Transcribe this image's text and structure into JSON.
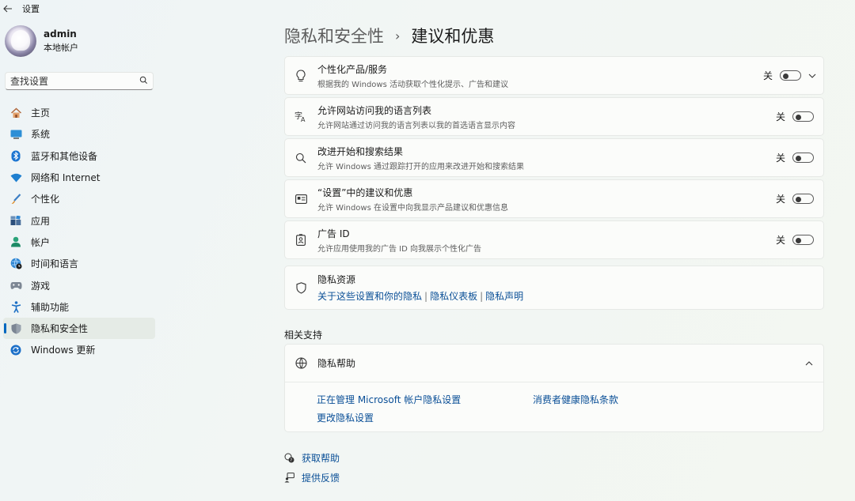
{
  "app": {
    "title": "设置"
  },
  "profile": {
    "name": "admin",
    "account_type": "本地帐户"
  },
  "search": {
    "placeholder": "查找设置"
  },
  "nav": [
    {
      "label": "主页",
      "icon": "home-icon"
    },
    {
      "label": "系统",
      "icon": "system-icon"
    },
    {
      "label": "蓝牙和其他设备",
      "icon": "bluetooth-icon"
    },
    {
      "label": "网络和 Internet",
      "icon": "wifi-icon"
    },
    {
      "label": "个性化",
      "icon": "brush-icon"
    },
    {
      "label": "应用",
      "icon": "apps-icon"
    },
    {
      "label": "帐户",
      "icon": "person-icon"
    },
    {
      "label": "时间和语言",
      "icon": "globe-clock-icon"
    },
    {
      "label": "游戏",
      "icon": "gamepad-icon"
    },
    {
      "label": "辅助功能",
      "icon": "accessibility-icon"
    },
    {
      "label": "隐私和安全性",
      "icon": "shield-icon",
      "active": true
    },
    {
      "label": "Windows 更新",
      "icon": "update-icon"
    }
  ],
  "breadcrumb": {
    "parent": "隐私和安全性",
    "separator": "›",
    "current": "建议和优惠"
  },
  "settings": [
    {
      "title": "个性化产品/服务",
      "desc": "根据我的 Windows 活动获取个性化提示、广告和建议",
      "state": "关",
      "icon": "lightbulb-icon",
      "expandable": true
    },
    {
      "title": "允许网站访问我的语言列表",
      "desc": "允许网站通过访问我的语言列表以我的首选语言显示内容",
      "state": "关",
      "icon": "language-icon"
    },
    {
      "title": "改进开始和搜索结果",
      "desc": "允许 Windows 通过跟踪打开的应用来改进开始和搜索结果",
      "state": "关",
      "icon": "search-icon"
    },
    {
      "title": "“设置”中的建议和优惠",
      "desc": "允许 Windows 在设置中向我显示产品建议和优惠信息",
      "state": "关",
      "icon": "settings-card-icon"
    },
    {
      "title": "广告 ID",
      "desc": "允许应用使用我的广告 ID 向我展示个性化广告",
      "state": "关",
      "icon": "id-badge-icon"
    }
  ],
  "privacy_resources": {
    "title": "隐私资源",
    "links": [
      "关于这些设置和你的隐私",
      "隐私仪表板",
      "隐私声明"
    ],
    "separator": "|"
  },
  "related": {
    "section_title": "相关支持",
    "help_title": "隐私帮助",
    "links": [
      "正在管理 Microsoft 帐户隐私设置",
      "消费者健康隐私条款",
      "更改隐私设置"
    ]
  },
  "footer": {
    "get_help": "获取帮助",
    "feedback": "提供反馈"
  },
  "colors": {
    "accent": "#0067c0",
    "link": "#0a4f97"
  }
}
